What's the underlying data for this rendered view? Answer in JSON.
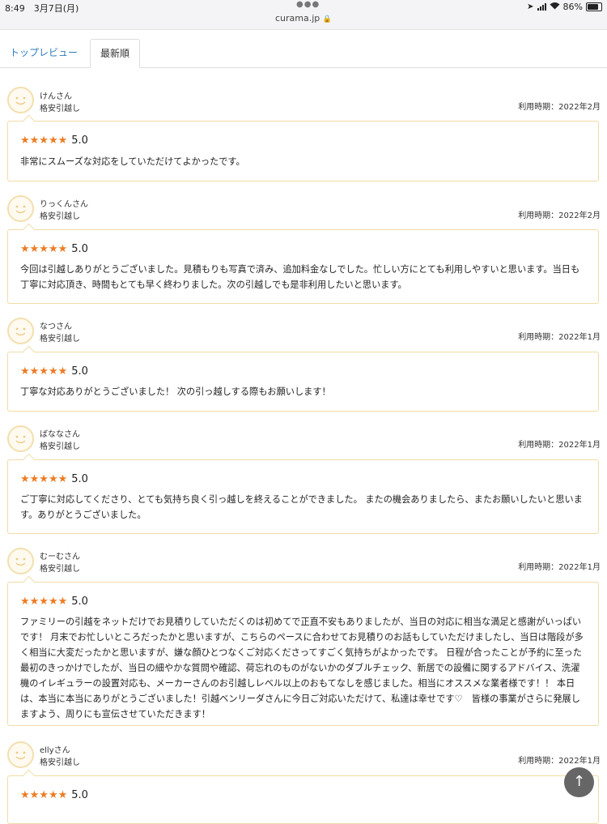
{
  "status_bar": {
    "time": "8:49　3月7日(月)",
    "url": "curama.jp",
    "battery": "86%"
  },
  "tabs": {
    "top_review": "トップレビュー",
    "newest": "最新順"
  },
  "usage_prefix": "利用時期：",
  "reviews": [
    {
      "name": "けんさん",
      "category": "格安引越し",
      "date": "利用時期：2022年2月",
      "stars": "★★★★★",
      "score": "5.0",
      "text": "非常にスムーズな対応をしていただけてよかったです。"
    },
    {
      "name": "りっくんさん",
      "category": "格安引越し",
      "date": "利用時期：2022年2月",
      "stars": "★★★★★",
      "score": "5.0",
      "text": "今回は引越しありがとうございました。見積もりも写真で済み、追加料金なしでした。忙しい方にとても利用しやすいと思います。当日も丁寧に対応頂き、時間もとても早く終わりました。次の引越しでも是非利用したいと思います。"
    },
    {
      "name": "なつさん",
      "category": "格安引越し",
      "date": "利用時期：2022年1月",
      "stars": "★★★★★",
      "score": "5.0",
      "text": "丁寧な対応ありがとうございました！ 次の引っ越しする際もお願いします！"
    },
    {
      "name": "ばななさん",
      "category": "格安引越し",
      "date": "利用時期：2022年1月",
      "stars": "★★★★★",
      "score": "5.0",
      "text": "ご丁寧に対応してくださり、とても気持ち良く引っ越しを終えることができました。 またの機会ありましたら、またお願いしたいと思います。ありがとうございました。"
    },
    {
      "name": "むーむさん",
      "category": "格安引越し",
      "date": "利用時期：2022年1月",
      "stars": "★★★★★",
      "score": "5.0",
      "text": "ファミリーの引越をネットだけでお見積りしていただくのは初めてで正直不安もありましたが、当日の対応に相当な満足と感謝がいっぱいです！ 月末でお忙しいところだったかと思いますが、こちらのペースに合わせてお見積りのお話もしていただけましたし、当日は階段が多く相当に大変だったかと思いますが、嫌な顔ひとつなくご対応くださってすごく気持ちがよかったです。 日程が合ったことが予約に至った最初のきっかけでしたが、当日の細やかな質問や確認、荷忘れのものがないかのダブルチェック、新居での設備に関するアドバイス、洗濯機のイレギュラーの設置対応も、メーカーさんのお引越しレベル以上のおもてなしを感じました。相当にオススメな業者様です！！ 本日は、本当に本当にありがとうございました！引越ベンリーダさんに今日ご対応いただけて、私達は幸せです♡　皆様の事業がさらに発展しますよう、周りにも宣伝させていただきます！"
    },
    {
      "name": "ellyさん",
      "category": "格安引越し",
      "date": "利用時期：2022年1月",
      "stars": "★★★★★",
      "score": "5.0",
      "text": ""
    }
  ],
  "back_to_top_icon": "arrow-up-icon"
}
